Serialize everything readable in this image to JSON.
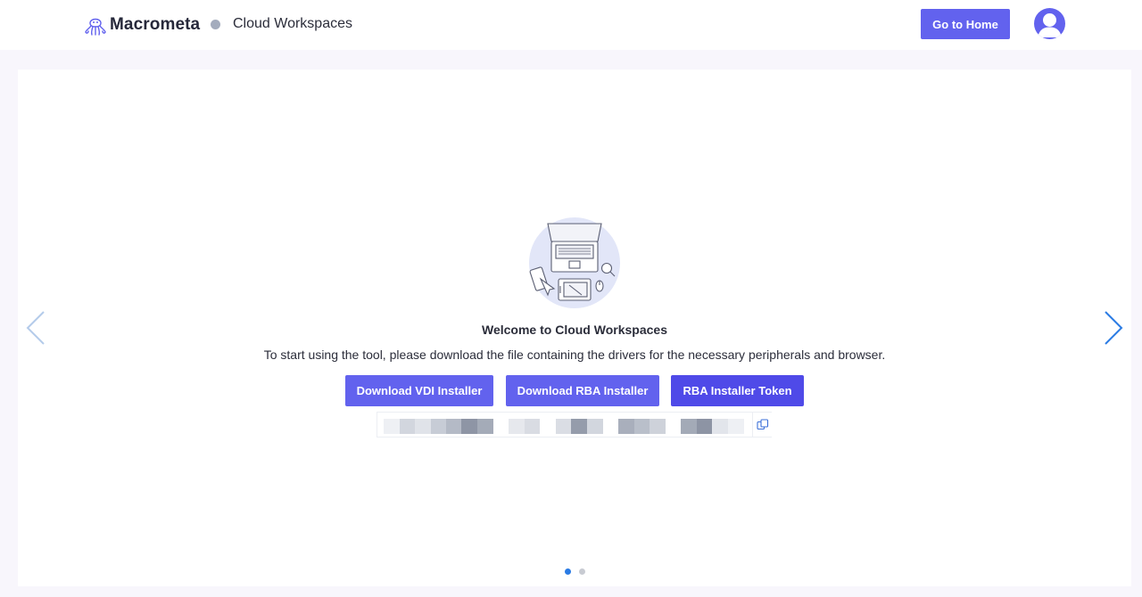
{
  "header": {
    "brand_name": "Macrometa",
    "title": "Cloud Workspaces",
    "home_button": "Go to Home",
    "accent_color": "#6262ee"
  },
  "carousel": {
    "welcome_title": "Welcome to Cloud Workspaces",
    "description": "To start using the tool, please download the file containing the drivers for the necessary peripherals and browser.",
    "buttons": {
      "vdi": "Download VDI Installer",
      "rba": "Download RBA Installer",
      "token": "RBA Installer Token"
    },
    "token_field": {
      "value": "···· ····",
      "state": "obscured"
    },
    "page_count": 2,
    "active_page": 1,
    "icons": {
      "prev": "chevron-left-icon",
      "next": "chevron-right-icon",
      "copy": "copy-icon",
      "illustration": "laptop-illustration"
    }
  }
}
